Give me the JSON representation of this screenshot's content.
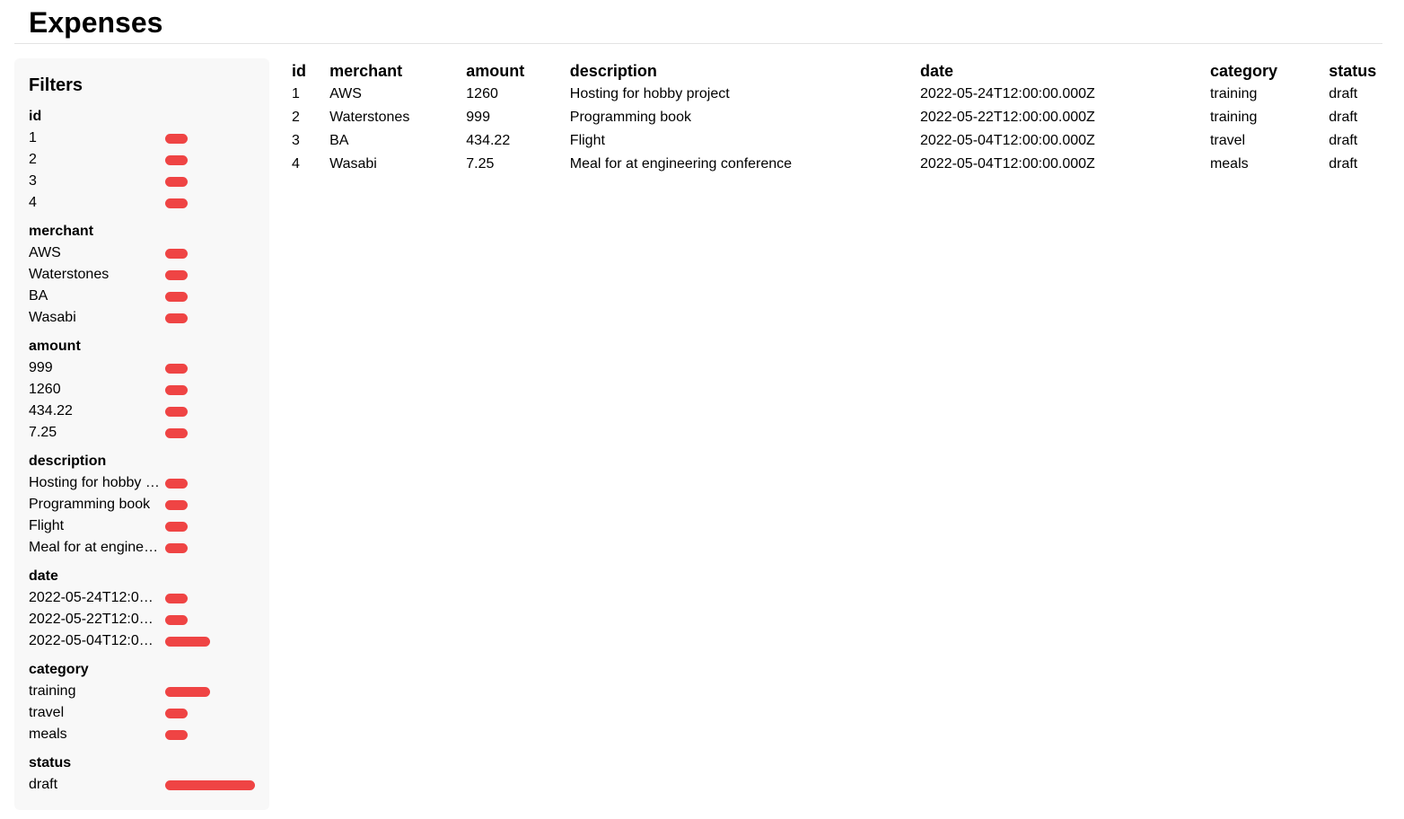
{
  "page": {
    "title": "Expenses"
  },
  "filters": {
    "title": "Filters",
    "bar_color": "#ef4444",
    "groups": [
      {
        "title": "id",
        "items": [
          {
            "label": "1",
            "count": 1
          },
          {
            "label": "2",
            "count": 1
          },
          {
            "label": "3",
            "count": 1
          },
          {
            "label": "4",
            "count": 1
          }
        ]
      },
      {
        "title": "merchant",
        "items": [
          {
            "label": "AWS",
            "count": 1
          },
          {
            "label": "Waterstones",
            "count": 1
          },
          {
            "label": "BA",
            "count": 1
          },
          {
            "label": "Wasabi",
            "count": 1
          }
        ]
      },
      {
        "title": "amount",
        "items": [
          {
            "label": "999",
            "count": 1
          },
          {
            "label": "1260",
            "count": 1
          },
          {
            "label": "434.22",
            "count": 1
          },
          {
            "label": "7.25",
            "count": 1
          }
        ]
      },
      {
        "title": "description",
        "items": [
          {
            "label": "Hosting for hobby project",
            "count": 1
          },
          {
            "label": "Programming book",
            "count": 1
          },
          {
            "label": "Flight",
            "count": 1
          },
          {
            "label": "Meal for at engineering conference",
            "count": 1
          }
        ]
      },
      {
        "title": "date",
        "items": [
          {
            "label": "2022-05-24T12:00:00.000Z",
            "count": 1
          },
          {
            "label": "2022-05-22T12:00:00.000Z",
            "count": 1
          },
          {
            "label": "2022-05-04T12:00:00.000Z",
            "count": 2
          }
        ]
      },
      {
        "title": "category",
        "items": [
          {
            "label": "training",
            "count": 2
          },
          {
            "label": "travel",
            "count": 1
          },
          {
            "label": "meals",
            "count": 1
          }
        ]
      },
      {
        "title": "status",
        "items": [
          {
            "label": "draft",
            "count": 4
          }
        ]
      }
    ]
  },
  "table": {
    "columns": [
      "id",
      "merchant",
      "amount",
      "description",
      "date",
      "category",
      "status"
    ],
    "rows": [
      [
        "1",
        "AWS",
        "1260",
        "Hosting for hobby project",
        "2022-05-24T12:00:00.000Z",
        "training",
        "draft"
      ],
      [
        "2",
        "Waterstones",
        "999",
        "Programming book",
        "2022-05-22T12:00:00.000Z",
        "training",
        "draft"
      ],
      [
        "3",
        "BA",
        "434.22",
        "Flight",
        "2022-05-04T12:00:00.000Z",
        "travel",
        "draft"
      ],
      [
        "4",
        "Wasabi",
        "7.25",
        "Meal for at engineering conference",
        "2022-05-04T12:00:00.000Z",
        "meals",
        "draft"
      ]
    ]
  }
}
